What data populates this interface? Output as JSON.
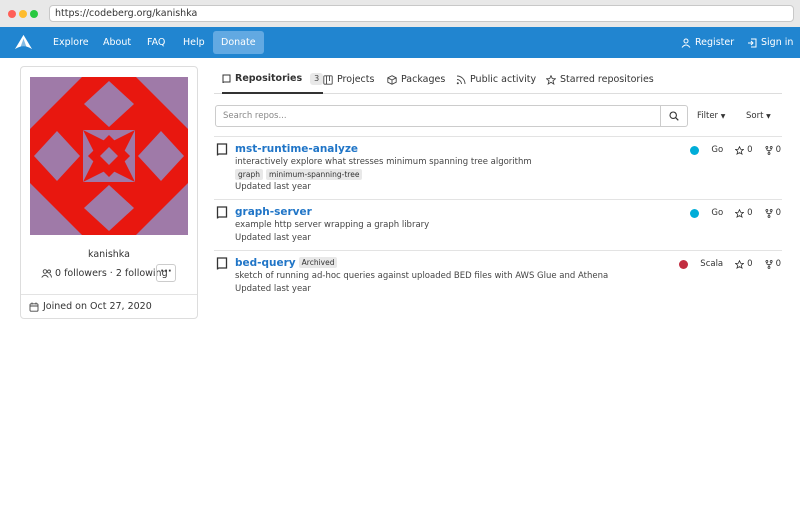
{
  "browser": {
    "url": "https://codeberg.org/kanishka"
  },
  "nav": {
    "items": [
      "Explore",
      "About",
      "FAQ",
      "Help"
    ],
    "donate": "Donate",
    "register": "Register",
    "signin": "Sign in"
  },
  "profile": {
    "username": "kanishka",
    "follow_text": "0 followers · 2 following",
    "joined": "Joined on Oct 27, 2020",
    "avatar_colors": {
      "background": "#e8170f",
      "shape": "#9f7aa8"
    }
  },
  "tabs": [
    {
      "label": "Repositories",
      "count": "3"
    },
    {
      "label": "Projects"
    },
    {
      "label": "Packages"
    },
    {
      "label": "Public activity"
    },
    {
      "label": "Starred repositories"
    }
  ],
  "search": {
    "placeholder": "Search repos...",
    "filter": "Filter",
    "sort": "Sort"
  },
  "repos": [
    {
      "name": "mst-runtime-analyze",
      "description": "interactively explore what stresses minimum spanning tree algorithm",
      "topics": [
        "graph",
        "minimum-spanning-tree"
      ],
      "updated": "Updated last year",
      "language": "Go",
      "language_color": "#00add8",
      "stars": "0",
      "forks": "0"
    },
    {
      "name": "graph-server",
      "description": "example http server wrapping a graph library",
      "updated": "Updated last year",
      "language": "Go",
      "language_color": "#00add8",
      "stars": "0",
      "forks": "0"
    },
    {
      "name": "bed-query",
      "archived": "Archived",
      "description": "sketch of running ad-hoc queries against uploaded BED files with AWS Glue and Athena",
      "updated": "Updated last year",
      "language": "Scala",
      "language_color": "#c22d40",
      "stars": "0",
      "forks": "0"
    }
  ]
}
